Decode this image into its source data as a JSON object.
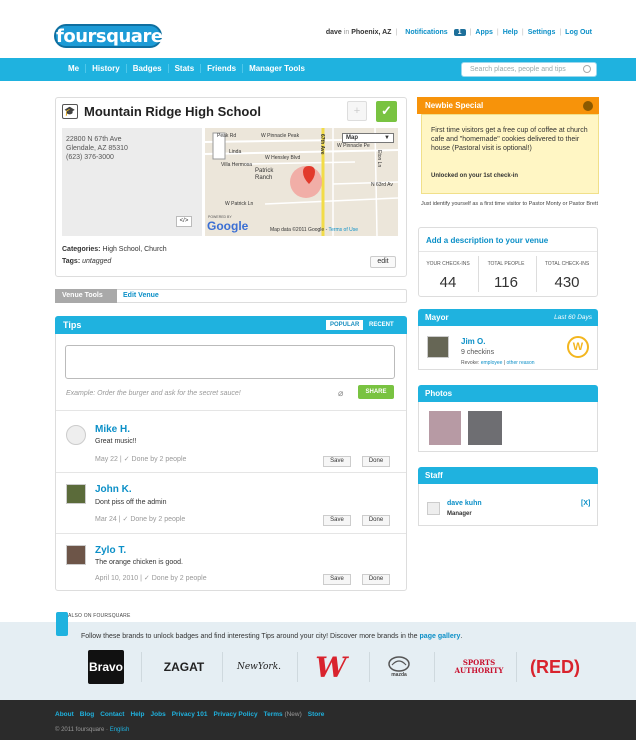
{
  "header": {
    "logo": "foursquare",
    "user": "dave",
    "in_word": "in",
    "location": "Phoenix, AZ",
    "notifications_label": "Notifications",
    "notifications_count": "1",
    "links": [
      "Apps",
      "Help",
      "Settings",
      "Log Out"
    ]
  },
  "nav": {
    "items": [
      "Me",
      "History",
      "Badges",
      "Stats",
      "Friends",
      "Manager Tools"
    ],
    "search_placeholder": "Search places, people and tips"
  },
  "venue": {
    "title": "Mountain Ridge High School",
    "address_line1": "22800 N 67th Ave",
    "address_line2": "Glendale, AZ 85310",
    "phone": "(623) 376-3000",
    "embed_label": "</>",
    "map_type": "Map",
    "map_labels": [
      "Peak Rd",
      "W Pinnacle Peak",
      "W Pinnacle Pe",
      "W Hensley Blvd",
      "Villa Hermosa",
      "Patrick Ranch",
      "W Patrick Ln",
      "67th Ave",
      "N 63rd Av",
      "Linda",
      "Eton Ln"
    ],
    "powered_by": "POWERED BY",
    "google": "Google",
    "map_data": "Map data ©2011 Google",
    "terms": "Terms of Use",
    "categories_label": "Categories:",
    "categories": "High School, Church",
    "tags_label": "Tags:",
    "tags": "untagged",
    "edit_label": "edit"
  },
  "venue_tools": {
    "active": "Venue Tools",
    "edit": "Edit Venue"
  },
  "tips": {
    "title": "Tips",
    "tab_popular": "POPULAR",
    "tab_recent": "RECENT",
    "placeholder": "Example: Order the burger and ask for the secret sauce!",
    "share_label": "SHARE",
    "items": [
      {
        "name": "Mike H.",
        "text": "Great music!!",
        "date": "May 22",
        "done": "Done by 2 people",
        "save": "Save",
        "done_btn": "Done"
      },
      {
        "name": "John K.",
        "text": "Dont piss off the admin",
        "date": "Mar 24",
        "done": "Done by 2 people",
        "save": "Save",
        "done_btn": "Done"
      },
      {
        "name": "Zylo T.",
        "text": "The orange chicken is good.",
        "date": "April 10, 2010",
        "done": "Done by 2 people",
        "save": "Save",
        "done_btn": "Done"
      }
    ]
  },
  "newbie": {
    "title": "Newbie Special",
    "text": "First time visitors get a free cup of coffee at church cafe and \"homemade\" cookies delivered to their house (Pastoral visit is optional!)",
    "unlock": "Unlocked on your 1st check-in",
    "identify": "Just identify yourself as a first time visitor to Pastor Monty or Pastor Brett"
  },
  "stats": {
    "description_link": "Add a description to your venue",
    "labels": [
      "YOUR CHECK-INS",
      "TOTAL PEOPLE",
      "TOTAL CHECK-INS"
    ],
    "values": [
      "44",
      "116",
      "430"
    ]
  },
  "mayor": {
    "title": "Mayor",
    "period": "Last 60 Days",
    "name": "Jim O.",
    "checkins": "9 checkins",
    "revoke_label": "Revoke:",
    "revoke_employee": "employee",
    "revoke_sep": "|",
    "revoke_other": "other reason",
    "crown": "W"
  },
  "photos": {
    "title": "Photos"
  },
  "staff": {
    "title": "Staff",
    "name": "dave kuhn",
    "role": "Manager",
    "remove": "[X]"
  },
  "brands": {
    "also_label": "ALSO ON FOURSQUARE",
    "text": "Follow these brands to unlock badges and find interesting Tips around your city! Discover more brands in the",
    "gallery_link": "page gallery",
    "period": ".",
    "items": [
      "Bravo",
      "ZAGAT",
      "NewYork.",
      "W",
      "mazda",
      "SPORTS AUTHORITY",
      "(RED)"
    ]
  },
  "footer": {
    "links": [
      "About",
      "Blog",
      "Contact",
      "Help",
      "Jobs",
      "Privacy 101",
      "Privacy Policy",
      "Terms",
      "(New)",
      "Store"
    ],
    "copyright": "© 2011 foursquare ·",
    "language": "English"
  },
  "colors": {
    "brand_blue": "#1fb2df",
    "link_blue": "#0b8fc7",
    "check_green": "#79c341",
    "newbie_orange": "#f7930a",
    "footer_dark": "#2b2b2b"
  }
}
